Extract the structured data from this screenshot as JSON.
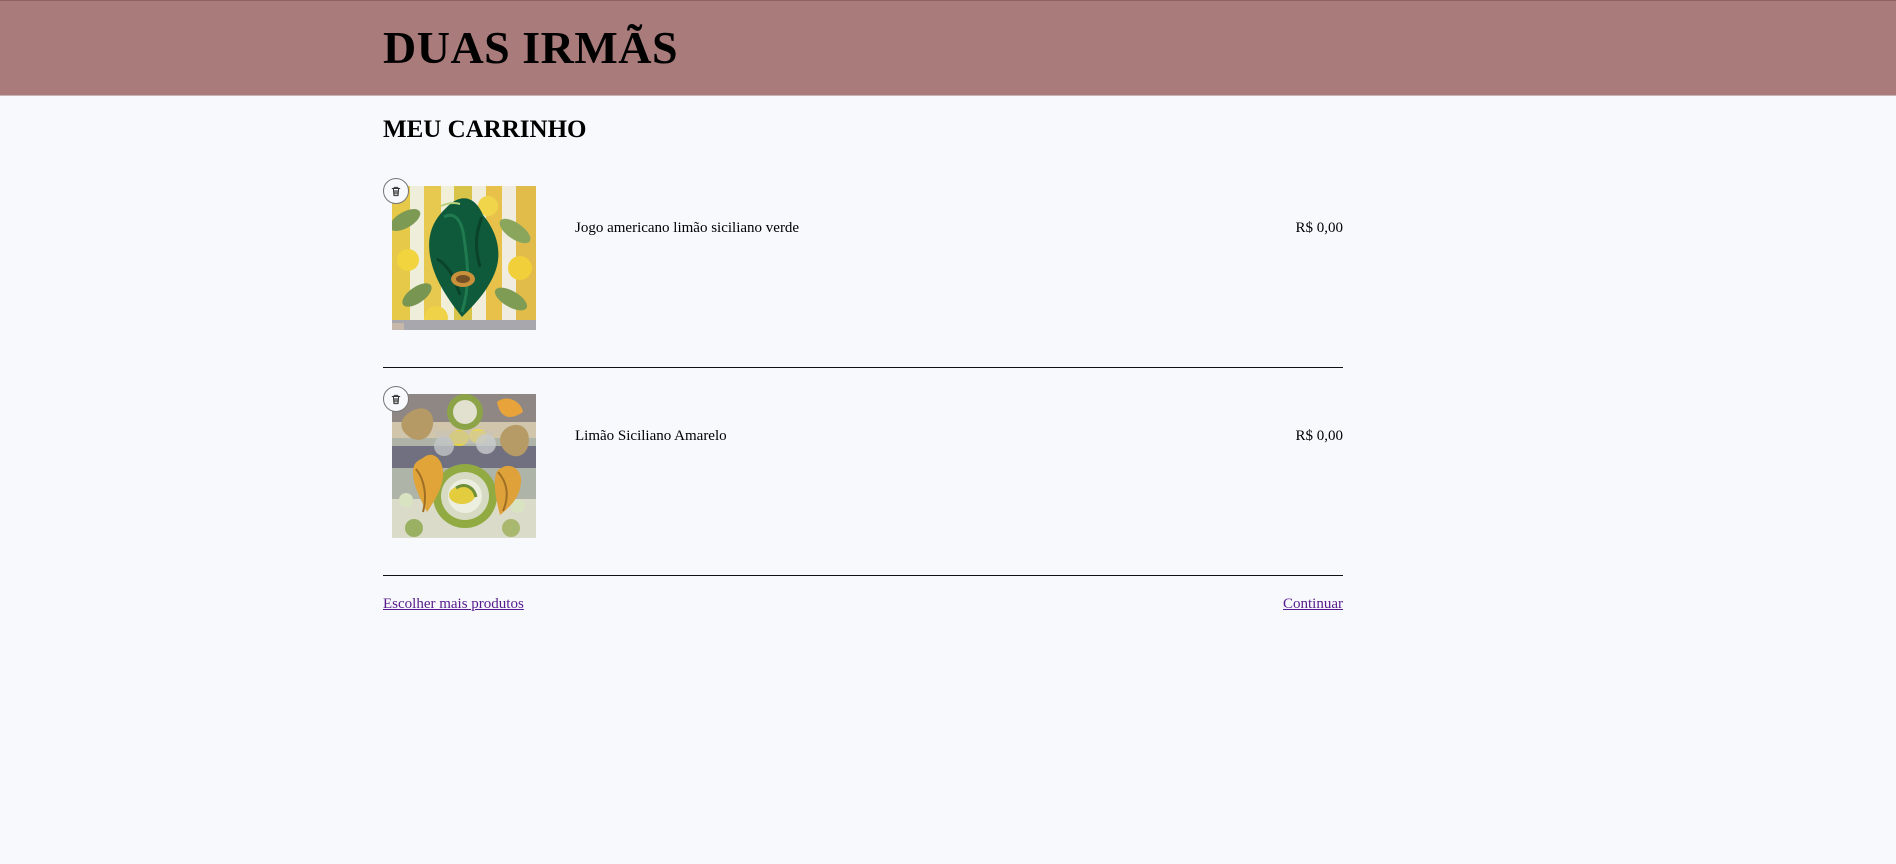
{
  "header": {
    "brand": "DUAS IRMÃS",
    "color": "#a97b7b"
  },
  "cart": {
    "title": "MEU CARRINHO",
    "items": [
      {
        "name": "Jogo americano limão siciliano verde",
        "price": "R$ 0,00",
        "thumbnail": "product-photo-green-napkin-on-lemon-placemat",
        "remove_icon": "trash-icon"
      },
      {
        "name": "Limão Siciliano Amarelo",
        "price": "R$ 0,00",
        "thumbnail": "product-photo-lemon-table-setting",
        "remove_icon": "trash-icon"
      }
    ]
  },
  "footer": {
    "more_products_label": "Escolher mais produtos",
    "continue_label": "Continuar",
    "link_color": "#551a8b"
  },
  "page": {
    "background": "#f8f9fd"
  }
}
